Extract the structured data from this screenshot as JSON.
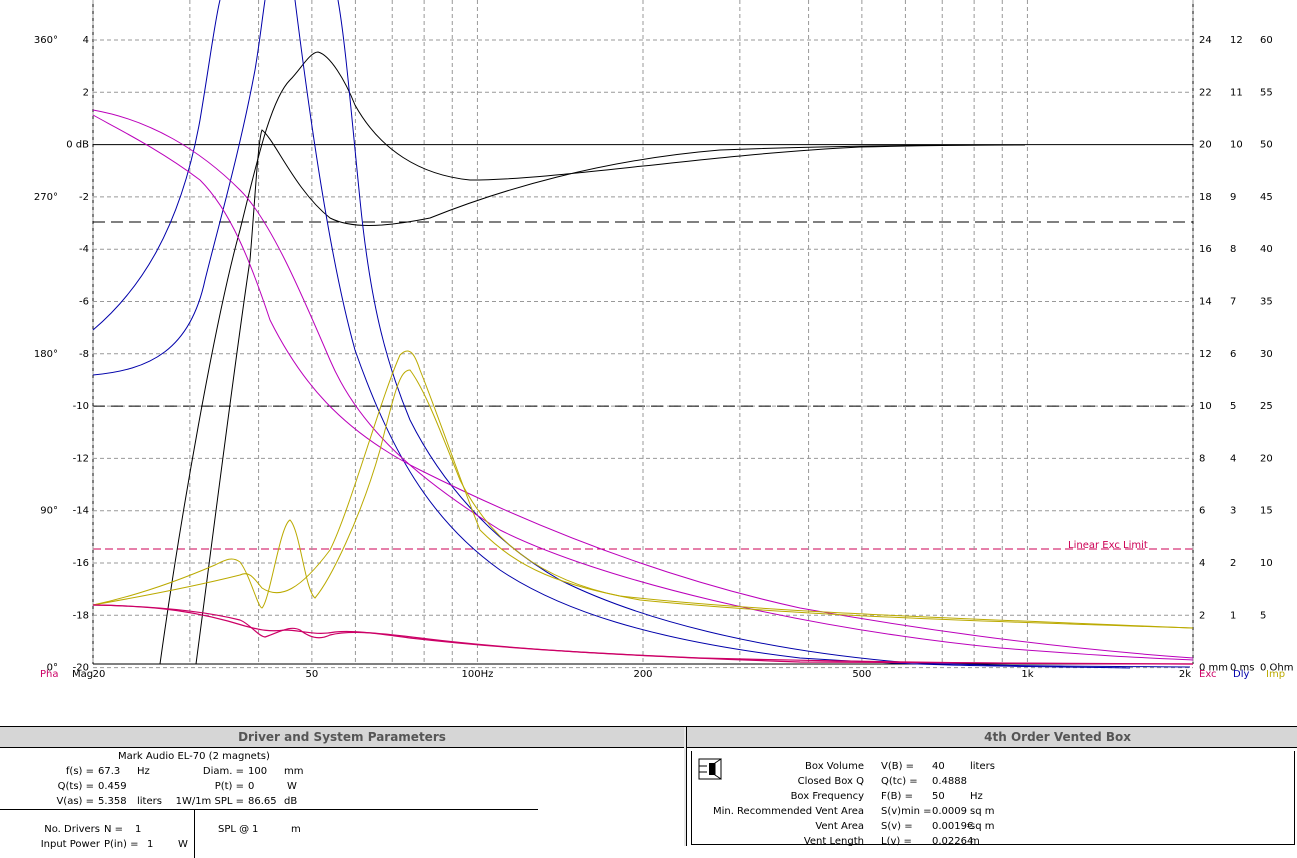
{
  "plot": {
    "left_ticks": [
      {
        "db": "4",
        "deg": "360°"
      },
      {
        "db": "2",
        "deg": ""
      },
      {
        "db": "0 dB",
        "deg": ""
      },
      {
        "db": "-2",
        "deg": "270°"
      },
      {
        "db": "-4",
        "deg": ""
      },
      {
        "db": "-6",
        "deg": ""
      },
      {
        "db": "-8",
        "deg": "180°"
      },
      {
        "db": "-10",
        "deg": ""
      },
      {
        "db": "-12",
        "deg": ""
      },
      {
        "db": "-14",
        "deg": "90°"
      },
      {
        "db": "-16",
        "deg": ""
      },
      {
        "db": "-18",
        "deg": ""
      },
      {
        "db": "-20",
        "deg": "0°"
      }
    ],
    "right_ticks": [
      [
        "24",
        "12",
        "60"
      ],
      [
        "22",
        "11",
        "55"
      ],
      [
        "20",
        "10",
        "50"
      ],
      [
        "18",
        "9",
        "45"
      ],
      [
        "16",
        "8",
        "40"
      ],
      [
        "14",
        "7",
        "35"
      ],
      [
        "12",
        "6",
        "30"
      ],
      [
        "10",
        "5",
        "25"
      ],
      [
        "8",
        "4",
        "20"
      ],
      [
        "6",
        "3",
        "15"
      ],
      [
        "4",
        "2",
        "10"
      ],
      [
        "2",
        "1",
        "5"
      ],
      [
        "0 mm",
        "0 ms",
        "0 Ohm"
      ]
    ],
    "x_ticks": [
      "20",
      "50",
      "100Hz",
      "200",
      "500",
      "1k",
      "2k"
    ],
    "axis_labels": {
      "pha": "Pha",
      "mag": "Mag",
      "exc": "Exc",
      "dly": "Dly",
      "imp": "Imp"
    },
    "linear_exc_label": "Linear Exc Limit",
    "colors": {
      "pha": "#cc0066",
      "exc": "#cc0066",
      "dly": "#0000aa",
      "imp": "#bbaa00",
      "magenta": "#bb00bb",
      "limit": "#cc0055"
    }
  },
  "driver_panel": {
    "title": "Driver and System Parameters",
    "driver_name": "Mark Audio EL-70 (2 magnets)",
    "fs_label": "f(s) =",
    "fs_value": "67.3",
    "fs_unit": "Hz",
    "qts_label": "Q(ts) =",
    "qts_value": "0.459",
    "vas_label": "V(as) =",
    "vas_value": "5.358",
    "vas_unit": "liters",
    "diam_label": "Diam. =",
    "diam_value": "100",
    "diam_unit": "mm",
    "pt_label": "P(t) =",
    "pt_value": "0",
    "pt_unit": "W",
    "spl_label": "1W/1m SPL =",
    "spl_value": "86.65",
    "spl_unit": "dB",
    "nd_label": "No. Drivers",
    "nd_sym": "N =",
    "nd_value": "1",
    "ip_label": "Input Power",
    "ip_sym": "P(in) =",
    "ip_value": "1",
    "ip_unit": "W",
    "splat_label": "SPL @",
    "splat_value": "1",
    "splat_unit": "m"
  },
  "box_panel": {
    "title": "4th Order Vented Box",
    "rows": [
      {
        "label": "Box Volume",
        "sym": "V(B) =",
        "value": "40",
        "unit": "liters"
      },
      {
        "label": "Closed Box Q",
        "sym": "Q(tc) =",
        "value": "0.4888",
        "unit": ""
      },
      {
        "label": "Box Frequency",
        "sym": "F(B) =",
        "value": "50",
        "unit": "Hz"
      },
      {
        "label": "Min. Recommended Vent Area",
        "sym": "S(v)min =",
        "value": "0.0009",
        "unit": "sq m"
      },
      {
        "label": "Vent Area",
        "sym": "S(v) =",
        "value": "0.0019€",
        "unit": "sq m"
      },
      {
        "label": "Vent Length",
        "sym": "L(v) =",
        "value": "0.02264",
        "unit": "m"
      }
    ]
  }
}
